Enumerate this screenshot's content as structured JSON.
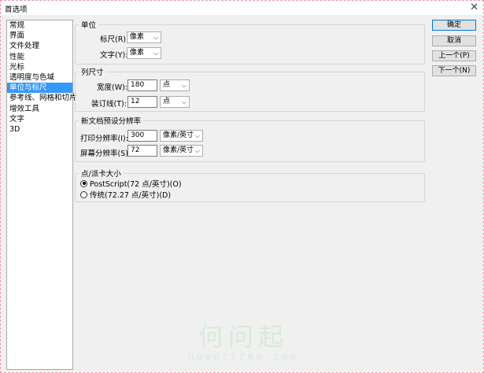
{
  "window": {
    "title": "首选项",
    "close": "✕"
  },
  "sidebar": {
    "items": [
      {
        "label": "常规"
      },
      {
        "label": "界面"
      },
      {
        "label": "文件处理"
      },
      {
        "label": "性能"
      },
      {
        "label": "光标"
      },
      {
        "label": "透明度与色域"
      },
      {
        "label": "单位与标尺"
      },
      {
        "label": "参考线、网格和切片"
      },
      {
        "label": "增效工具"
      },
      {
        "label": "文字"
      },
      {
        "label": "3D"
      }
    ],
    "selected": "单位与标尺"
  },
  "units": {
    "legend": "单位",
    "ruler_label": "标尺(R):",
    "ruler_value": "像素",
    "type_label": "文字(Y):",
    "type_value": "像素"
  },
  "column": {
    "legend": "列尺寸",
    "width_label": "宽度(W):",
    "width_value": "180",
    "width_unit": "点",
    "gutter_label": "装订线(T):",
    "gutter_value": "12",
    "gutter_unit": "点"
  },
  "resolution": {
    "legend": "新文档预设分辨率",
    "print_label": "打印分辨率(I):",
    "print_value": "300",
    "print_unit": "像素/英寸",
    "screen_label": "屏幕分辨率(S):",
    "screen_value": "72",
    "screen_unit": "像素/英寸"
  },
  "point": {
    "legend": "点/派卡大小",
    "option1": "PostScript(72 点/英寸)(O)",
    "option2": "传统(72.27 点/英寸)(D)",
    "selected": "option1"
  },
  "buttons": {
    "ok": "确定",
    "cancel": "取消",
    "prev": "上一个(P)",
    "next": "下一个(N)"
  },
  "watermark": {
    "text": "何问起",
    "url": "hovertree.com"
  },
  "colors": {
    "selection": "#3399ff",
    "frame_border": "#e89aa7",
    "watermark": "#d6ecd8"
  }
}
